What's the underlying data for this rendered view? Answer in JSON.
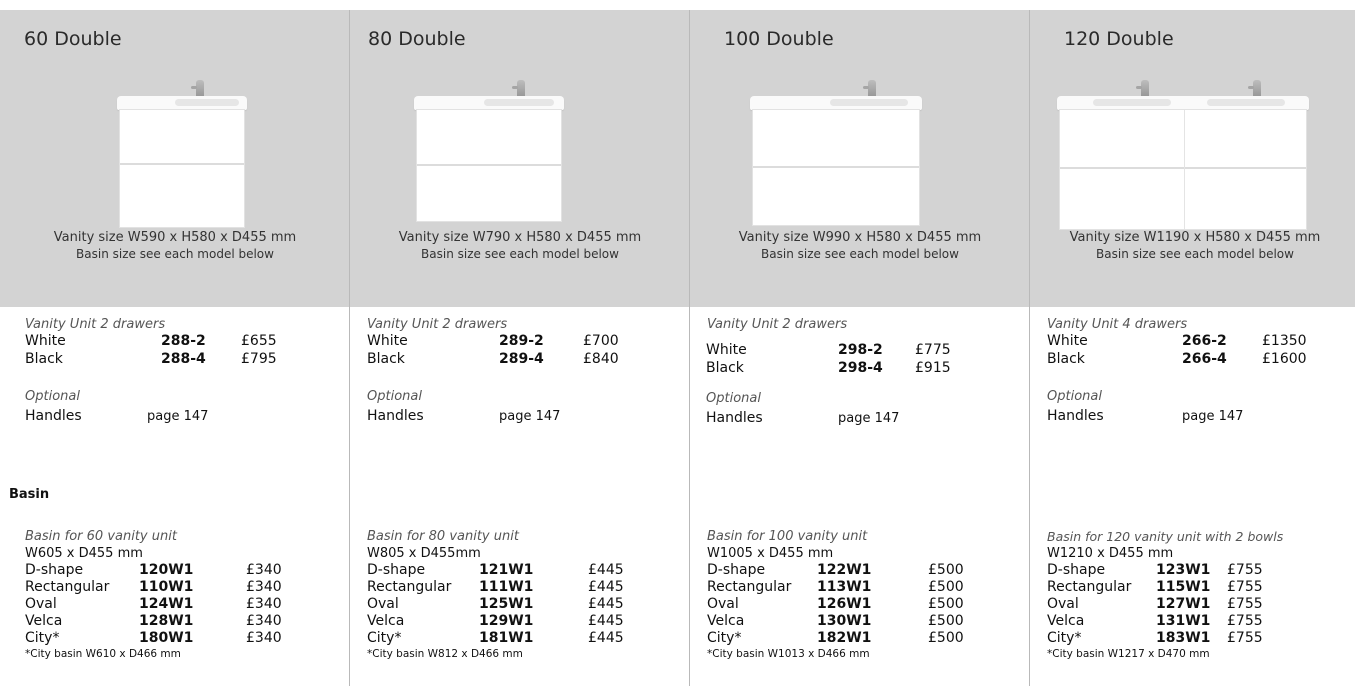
{
  "section_heading": "Basin",
  "columns": [
    {
      "title": "60 Double",
      "vanity_size": "Vanity size W590 x H580 x D455 mm",
      "basin_note": "Basin size see each model below",
      "unit_label": "Vanity Unit 2 drawers",
      "units": [
        {
          "name": "White",
          "code": "288-2",
          "price": "£655"
        },
        {
          "name": "Black",
          "code": "288-4",
          "price": "£795"
        }
      ],
      "optional_label": "Optional",
      "handles": {
        "name": "Handles",
        "ref": "page 147"
      },
      "basin_for": "Basin for 60 vanity unit",
      "basin_dims": "W605 x D455 mm",
      "basins": [
        {
          "name": "D-shape",
          "code": "120W1",
          "price": "£340"
        },
        {
          "name": "Rectangular",
          "code": "110W1",
          "price": "£340"
        },
        {
          "name": "Oval",
          "code": "124W1",
          "price": "£340"
        },
        {
          "name": "Velca",
          "code": "128W1",
          "price": "£340"
        },
        {
          "name": "City*",
          "code": "180W1",
          "price": "£340"
        }
      ],
      "footnote": "*City basin W610 x D466 mm"
    },
    {
      "title": "80 Double",
      "vanity_size": "Vanity size W790 x H580 x D455 mm",
      "basin_note": "Basin size see each model below",
      "unit_label": "Vanity Unit 2 drawers",
      "units": [
        {
          "name": "White",
          "code": "289-2",
          "price": "£700"
        },
        {
          "name": "Black",
          "code": "289-4",
          "price": "£840"
        }
      ],
      "optional_label": "Optional",
      "handles": {
        "name": "Handles",
        "ref": "page 147"
      },
      "basin_for": "Basin for 80 vanity unit",
      "basin_dims": "W805 x D455mm",
      "basins": [
        {
          "name": "D-shape",
          "code": "121W1",
          "price": "£445"
        },
        {
          "name": "Rectangular",
          "code": "111W1",
          "price": "£445"
        },
        {
          "name": "Oval",
          "code": "125W1",
          "price": "£445"
        },
        {
          "name": "Velca",
          "code": "129W1",
          "price": "£445"
        },
        {
          "name": "City*",
          "code": "181W1",
          "price": "£445"
        }
      ],
      "footnote": "*City basin W812 x D466 mm"
    },
    {
      "title": "100 Double",
      "vanity_size": "Vanity size W990 x H580 x D455 mm",
      "basin_note": "Basin size see each model below",
      "unit_label": "Vanity Unit 2 drawers",
      "units": [
        {
          "name": "White",
          "code": "298-2",
          "price": "£775"
        },
        {
          "name": "Black",
          "code": "298-4",
          "price": "£915"
        }
      ],
      "optional_label": "Optional",
      "handles": {
        "name": "Handles",
        "ref": "page 147"
      },
      "basin_for": "Basin for 100 vanity unit",
      "basin_dims": "W1005 x D455 mm",
      "basins": [
        {
          "name": "D-shape",
          "code": "122W1",
          "price": "£500"
        },
        {
          "name": "Rectangular",
          "code": "113W1",
          "price": "£500"
        },
        {
          "name": "Oval",
          "code": "126W1",
          "price": "£500"
        },
        {
          "name": "Velca",
          "code": "130W1",
          "price": "£500"
        },
        {
          "name": "City*",
          "code": "182W1",
          "price": "£500"
        }
      ],
      "footnote": "*City basin W1013 x D466 mm"
    },
    {
      "title": "120 Double",
      "vanity_size": "Vanity size W1190 x H580 x D455 mm",
      "basin_note": "Basin size see each model below",
      "unit_label": "Vanity Unit 4 drawers",
      "units": [
        {
          "name": "White",
          "code": "266-2",
          "price": "£1350"
        },
        {
          "name": "Black",
          "code": "266-4",
          "price": "£1600"
        }
      ],
      "optional_label": "Optional",
      "handles": {
        "name": "Handles",
        "ref": "page 147"
      },
      "basin_for": "Basin for 120 vanity unit with 2 bowls",
      "basin_dims": "W1210 x D455 mm",
      "basins": [
        {
          "name": "D-shape",
          "code": "123W1",
          "price": "£755"
        },
        {
          "name": "Rectangular",
          "code": "115W1",
          "price": "£755"
        },
        {
          "name": "Oval",
          "code": "127W1",
          "price": "£755"
        },
        {
          "name": "Velca",
          "code": "131W1",
          "price": "£755"
        },
        {
          "name": "City*",
          "code": "183W1",
          "price": "£755"
        }
      ],
      "footnote": "*City basin W1217 x D470 mm"
    }
  ]
}
